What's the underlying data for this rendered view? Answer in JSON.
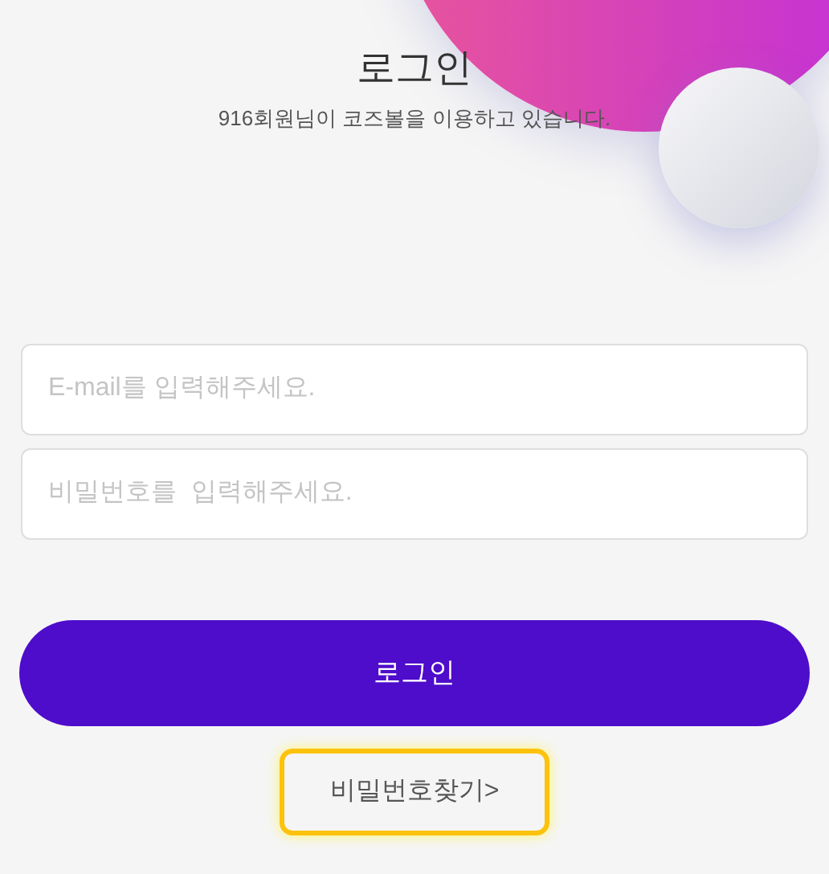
{
  "header": {
    "title": "로그인",
    "subtitle": "916회원님이 코즈볼을 이용하고 있습니다."
  },
  "fields": [
    {
      "placeholder": "E-mail를 입력해주세요."
    },
    {
      "placeholder": "비밀번호를  입력해주세요."
    }
  ],
  "login_button": "로그인",
  "find_password_link": {
    "label": "비밀번호찾기>",
    "highlighted": true
  }
}
